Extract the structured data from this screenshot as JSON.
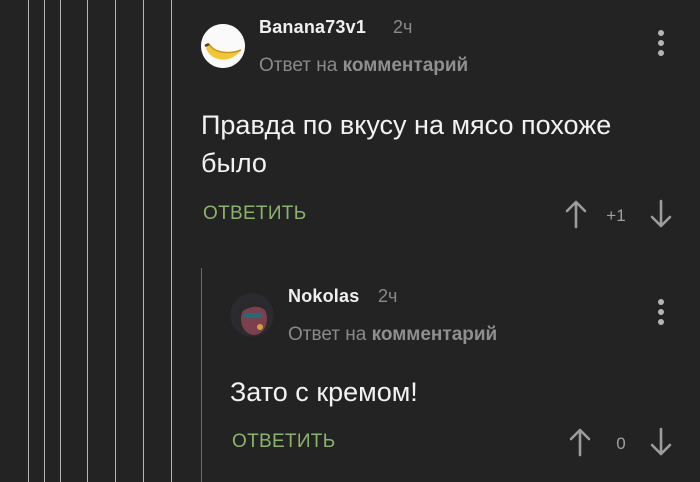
{
  "thread": {
    "comments": [
      {
        "username": "Banana73v1",
        "time": "2ч",
        "reply_prefix": "Ответ на",
        "reply_target": "комментарий",
        "text": "Правда по вкусу на мясо похоже было",
        "reply_label": "ОТВЕТИТЬ",
        "rating": "+1",
        "avatar_icon": "banana-icon"
      },
      {
        "username": "Nokolas",
        "time": "2ч",
        "reply_prefix": "Ответ на",
        "reply_target": "комментарий",
        "text": "Зато с кремом!",
        "reply_label": "ОТВЕТИТЬ",
        "rating": "0",
        "avatar_icon": "user-photo-avatar"
      }
    ]
  },
  "colors": {
    "background": "#232323",
    "reply_button": "#8bb36b",
    "muted_text": "#8a8a8a"
  }
}
